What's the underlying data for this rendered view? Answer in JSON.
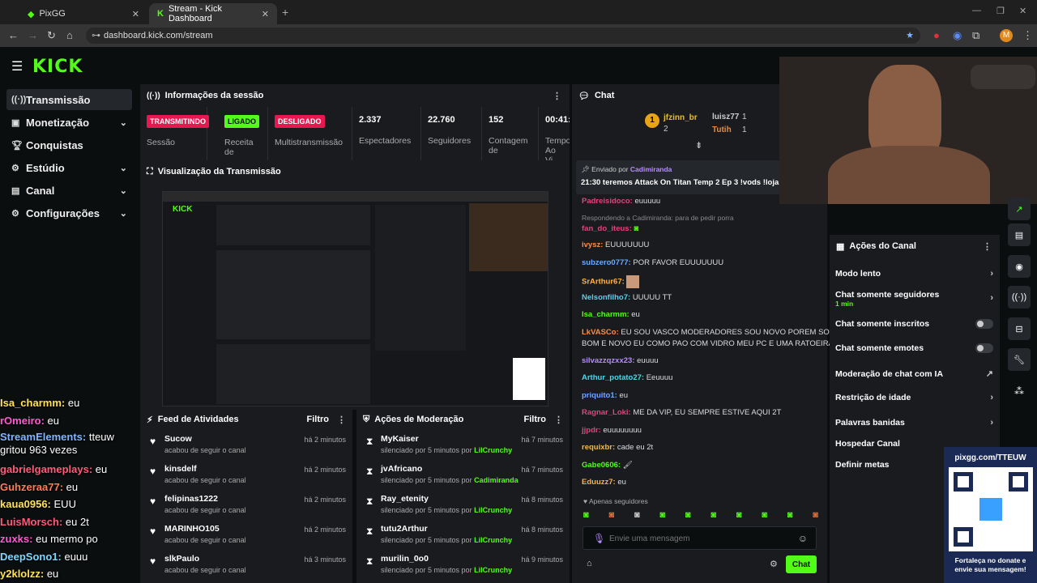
{
  "browser": {
    "tabs": [
      {
        "label": "PixGG"
      },
      {
        "label": "Stream - Kick Dashboard"
      }
    ],
    "url": "dashboard.kick.com/stream",
    "profile_initial": "M"
  },
  "logo": "KICK",
  "sidebar": {
    "items": [
      {
        "label": "Transmissão"
      },
      {
        "label": "Monetização"
      },
      {
        "label": "Conquistas"
      },
      {
        "label": "Estúdio"
      },
      {
        "label": "Canal"
      },
      {
        "label": "Configurações"
      }
    ]
  },
  "session": {
    "title": "Informações da sessão",
    "stats": [
      {
        "badge": "TRANSMITINDO",
        "label": "Sessão"
      },
      {
        "badge": "LIGADO",
        "label": "Receita de"
      },
      {
        "badge": "DESLIGADO",
        "label": "Multistransmissão"
      },
      {
        "value": "2.337",
        "label": "Espectadores"
      },
      {
        "value": "22.760",
        "label": "Seguidores"
      },
      {
        "value": "152",
        "label": "Contagem de"
      },
      {
        "value": "00:41:",
        "label": "Tempo Ao Vi"
      }
    ]
  },
  "preview": {
    "title": "Visualização da Transmissão"
  },
  "feed": {
    "title": "Feed de Atividades",
    "filter": "Filtro",
    "items": [
      {
        "name": "Sucow",
        "sub": "acabou de seguir o canal",
        "time": "há 2 minutos"
      },
      {
        "name": "kinsdelf",
        "sub": "acabou de seguir o canal",
        "time": "há 2 minutos"
      },
      {
        "name": "felipinas1222",
        "sub": "acabou de seguir o canal",
        "time": "há 2 minutos"
      },
      {
        "name": "MARINHO105",
        "sub": "acabou de seguir o canal",
        "time": "há 2 minutos"
      },
      {
        "name": "slkPaulo",
        "sub": "acabou de seguir o canal",
        "time": "há 3 minutos"
      }
    ]
  },
  "moderation": {
    "title": "Ações de Moderação",
    "filter": "Filtro",
    "items": [
      {
        "name": "MyKaiser",
        "sub": "silenciado por 5 minutos por",
        "by": "LilCrunchy",
        "time": "há 7 minutos"
      },
      {
        "name": "jvAfricano",
        "sub": "silenciado por 5 minutos por",
        "by": "Cadimiranda",
        "time": "há 7 minutos"
      },
      {
        "name": "Ray_etenity",
        "sub": "silenciado por 5 minutos por",
        "by": "LilCrunchy",
        "time": "há 8 minutos"
      },
      {
        "name": "tutu2Arthur",
        "sub": "silenciado por 5 minutos por",
        "by": "LilCrunchy",
        "time": "há 8 minutos"
      },
      {
        "name": "murilin_0o0",
        "sub": "silenciado por 5 minutos por",
        "by": "LilCrunchy",
        "time": "há 9 minutos"
      }
    ]
  },
  "chat": {
    "title": "Chat",
    "leaders": [
      {
        "name": "jfzinn_br",
        "count": "2"
      },
      {
        "name": "luisz77",
        "count": "1"
      },
      {
        "name": "Tutih",
        "count": "1"
      }
    ],
    "pinned_by_label": "Enviado por",
    "pinned_by": "Cadimiranda",
    "pinned_text": "21:30 teremos Attack On Titan Temp 2 Ep 3 !vods !loja",
    "reply_note": "Respondendo a Cadimiranda: para de pedir porra",
    "messages": [
      {
        "user": "Padreisidoco:",
        "text": "euuuuu",
        "color": "#e0457b"
      },
      {
        "user": "fan_do_iteus:",
        "text": "",
        "color": "#e0457b"
      },
      {
        "user": "ivysz:",
        "text": "EUUUUUUU",
        "color": "#ff8c42"
      },
      {
        "user": "subzero0777:",
        "text": "POR FAVOR EUUUUUUU",
        "color": "#6ea8ff"
      },
      {
        "user": "SrArthur67:",
        "text": "",
        "color": "#ffb347"
      },
      {
        "user": "Nelsonfilho7:",
        "text": "UUUUU TT",
        "color": "#56d3e8"
      },
      {
        "user": "Isa_charmm:",
        "text": "eu",
        "color": "#53fc18"
      },
      {
        "user": "LkVASCo:",
        "text": "EU SOU VASCO MODERADORES SOU NOVO POREM SOU",
        "color": "#ff8c42"
      },
      {
        "user": "",
        "text": "BOM E NOVO EU COMO PAO COM VIDRO MEU PC E UMA RATOEIRA",
        "color": "#ff8c42"
      },
      {
        "user": "silvazzqzxx23:",
        "text": "euuuu",
        "color": "#b78cff"
      },
      {
        "user": "Arthur_potato27:",
        "text": "Eeuuuu",
        "color": "#56d3e8"
      },
      {
        "user": "priquito1:",
        "text": "eu",
        "color": "#6ea8ff"
      },
      {
        "user": "Ragnar_Loki:",
        "text": "ME DA VIP, EU SEMPRE ESTIVE AQUI 2T",
        "color": "#e0457b"
      },
      {
        "user": "jjpdr:",
        "text": "euuuuuuuu",
        "color": "#e0457b"
      },
      {
        "user": "requixbr:",
        "text": "cade eu 2t",
        "color": "#ffb347"
      },
      {
        "user": "Gabe0606:",
        "text": "",
        "color": "#53fc18"
      },
      {
        "user": "Eduuzz7:",
        "text": "eu",
        "color": "#ffb347"
      }
    ],
    "followers_only": "Apenas seguidores",
    "input_placeholder": "Envie uma mensagem",
    "send_label": "Chat"
  },
  "actions": {
    "title": "Ações do Canal",
    "items": [
      {
        "label": "Modo lento"
      },
      {
        "label": "Chat somente seguidores",
        "sub": "1 min"
      },
      {
        "label": "Chat somente inscritos"
      },
      {
        "label": "Chat somente emotes"
      },
      {
        "label": "Moderação de chat com IA"
      },
      {
        "label": "Restrição de idade"
      },
      {
        "label": "Palavras banidas"
      },
      {
        "label": "Hospedar Canal"
      },
      {
        "label": "Definir metas"
      }
    ]
  },
  "overlay_chat": [
    {
      "user": "Isa_charmm:",
      "text": "eu",
      "color": "#ffe15a"
    },
    {
      "user": "rOmeiro:",
      "text": "eu",
      "color": "#ff5ad1"
    },
    {
      "user": "StreamElements:",
      "text": "tteuw",
      "color": "#7fb6ff"
    },
    {
      "user": "",
      "text": "gritou 963 vezes",
      "color": "#ffffff"
    },
    {
      "user": "gabrielgameplays:",
      "text": "eu",
      "color": "#ff5a7a"
    },
    {
      "user": "Guhzeraa77:",
      "text": "eu",
      "color": "#ff7a5a"
    },
    {
      "user": "kaua0956:",
      "text": "EUU",
      "color": "#ffe15a"
    },
    {
      "user": "LuisMorsch:",
      "text": "eu 2t",
      "color": "#ff5a7a"
    },
    {
      "user": "zuxks:",
      "text": "eu mermo po",
      "color": "#ff5ad1"
    },
    {
      "user": "DeepSono1:",
      "text": "euuu",
      "color": "#7fd7ff"
    },
    {
      "user": "y2klolzz:",
      "text": "eu",
      "color": "#ffe15a"
    }
  ],
  "qr": {
    "url": "pixgg.com/TTEUW",
    "caption": "Fortaleça no donate e envie sua mensagem!"
  }
}
